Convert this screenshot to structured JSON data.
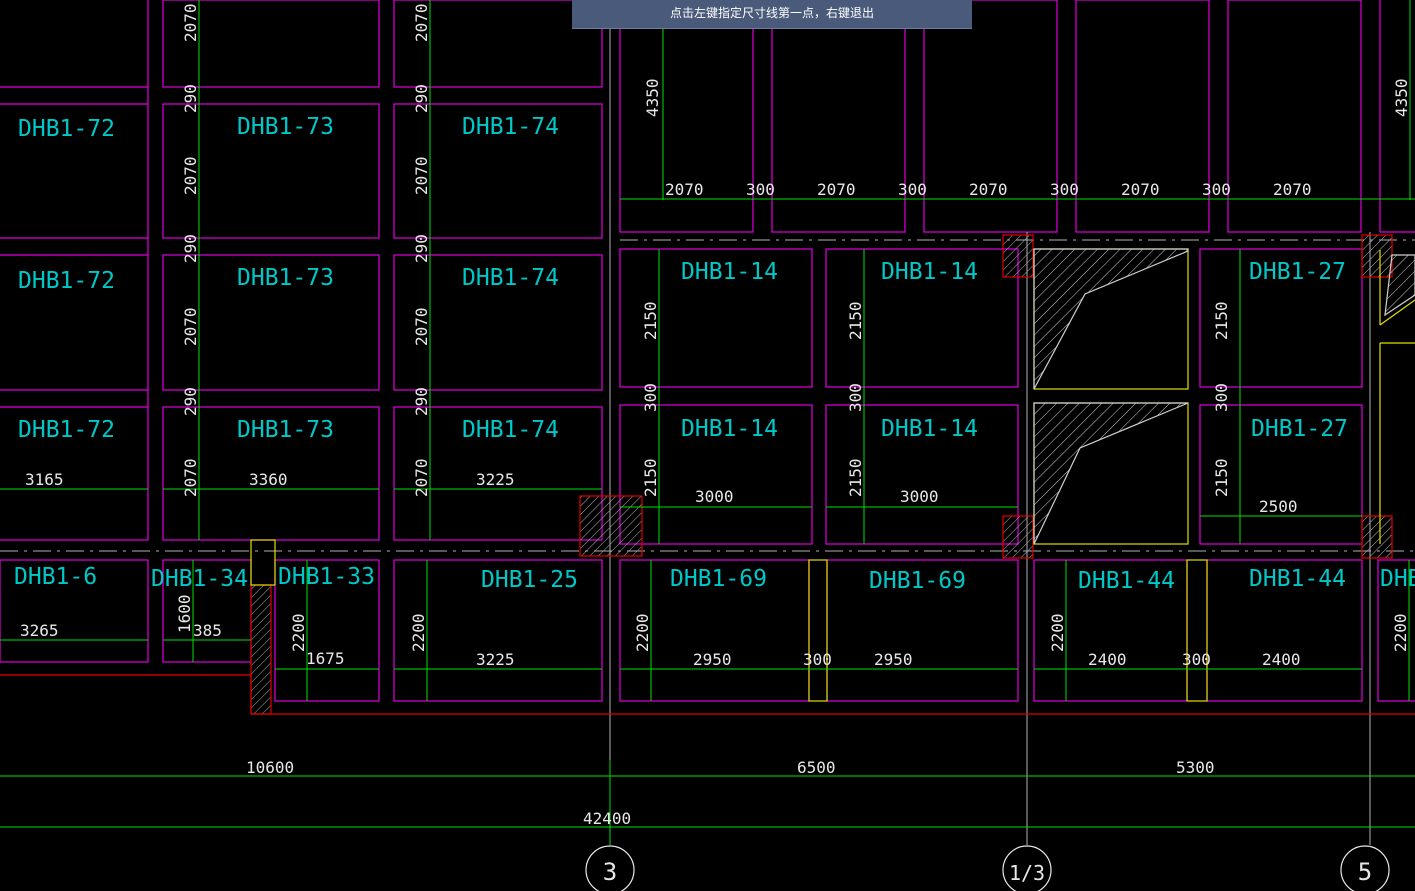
{
  "prompt": {
    "text": "点击左键指定尺寸线第一点，右键退出"
  },
  "colors": {
    "background": "#000000",
    "slab_outline": "#e000e0",
    "slab_label": "#00c8c8",
    "dimension_line": "#00e000",
    "dimension_text": "#e8e8e8",
    "wall_red": "#e00000",
    "opening_yellow": "#e0e000",
    "axis_grey": "#a0a0a0"
  },
  "slab_labels": [
    "DHB1-72",
    "DHB1-73",
    "DHB1-74",
    "DHB1-72",
    "DHB1-73",
    "DHB1-74",
    "DHB1-72",
    "DHB1-73",
    "DHB1-74",
    "DHB1-14",
    "DHB1-14",
    "DHB1-27",
    "DHB1-14",
    "DHB1-14",
    "DHB1-27",
    "DHB1-6",
    "DHB1-34",
    "DHB1-33",
    "DHB1-25",
    "DHB1-69",
    "DHB1-69",
    "DHB1-44",
    "DHB1-44",
    "DHB"
  ],
  "dimensions_horizontal": [
    "2070",
    "300",
    "2070",
    "300",
    "2070",
    "300",
    "2070",
    "300",
    "2070",
    "3165",
    "3360",
    "3225",
    "3000",
    "3000",
    "2500",
    "3265",
    "385",
    "1675",
    "3225",
    "2950",
    "300",
    "2950",
    "2400",
    "300",
    "2400",
    "10600",
    "6500",
    "5300",
    "42400"
  ],
  "dimensions_vertical": [
    "2070",
    "2070",
    "4350",
    "4350",
    "290",
    "290",
    "2070",
    "2070",
    "290",
    "290",
    "2070",
    "2070",
    "290",
    "290",
    "2070",
    "2070",
    "2150",
    "2150",
    "2150",
    "300",
    "300",
    "300",
    "2150",
    "2150",
    "2150",
    "1600",
    "2200",
    "2200",
    "2200",
    "2200",
    "2200"
  ],
  "axis_markers": [
    "3",
    "1/3",
    "5"
  ]
}
